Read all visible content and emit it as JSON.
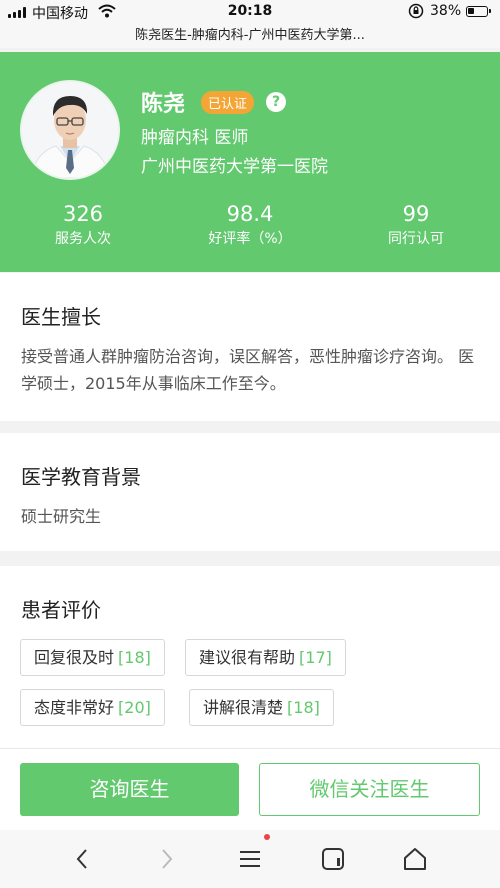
{
  "status_bar": {
    "carrier": "中国移动",
    "time": "20:18",
    "battery_percent": "38%",
    "battery_level": 0.38
  },
  "page_title": "陈尧医生-肿瘤内科-广州中医药大学第...",
  "doctor": {
    "name": "陈尧",
    "badge": "已认证",
    "help_icon": "?",
    "department": "肿瘤内科 医师",
    "hospital": "广州中医药大学第一医院",
    "stats": [
      {
        "value": "326",
        "label": "服务人次"
      },
      {
        "value": "98.4",
        "label": "好评率（%）"
      },
      {
        "value": "99",
        "label": "同行认可"
      }
    ]
  },
  "expertise": {
    "title": "医生擅长",
    "body": "接受普通人群肿瘤防治咨询，误区解答，恶性肿瘤诊疗咨询。 医学硕士，2015年从事临床工作至今。"
  },
  "education": {
    "title": "医学教育背景",
    "body": "硕士研究生"
  },
  "reviews": {
    "title": "患者评价",
    "tags": [
      {
        "label": "回复很及时",
        "count": "[18]"
      },
      {
        "label": "建议很有帮助",
        "count": "[17]"
      },
      {
        "label": "态度非常好",
        "count": "[20]"
      },
      {
        "label": "讲解很清楚",
        "count": "[18]"
      }
    ]
  },
  "actions": {
    "consult": "咨询医生",
    "follow": "微信关注医生"
  },
  "browser_nav": {
    "icons": [
      "back-icon",
      "forward-icon",
      "menu-icon",
      "tabs-icon",
      "home-icon"
    ]
  },
  "colors": {
    "accent": "#62c96f",
    "badge": "#f3a535",
    "notification_dot": "#e84545"
  }
}
